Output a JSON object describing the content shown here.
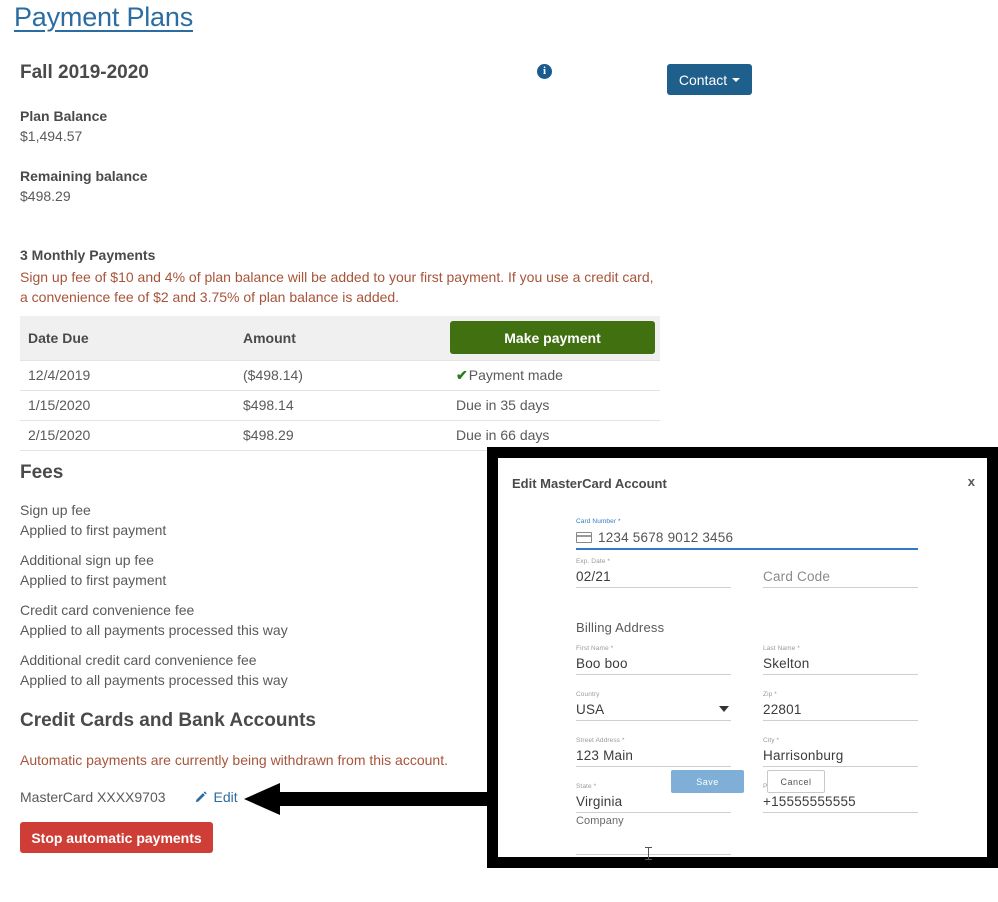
{
  "page": {
    "title": "Payment Plans"
  },
  "plan": {
    "name": "Fall 2019-2020",
    "info_icon": "info-icon",
    "contact_button": "Contact",
    "plan_balance_label": "Plan Balance",
    "plan_balance_value": "$1,494.57",
    "remaining_balance_label": "Remaining balance",
    "remaining_balance_value": "$498.29"
  },
  "schedule": {
    "title": "3 Monthly Payments",
    "note": "Sign up fee of $10 and 4% of plan balance will be added to your first payment. If you use a credit card, a convenience fee of $2 and 3.75% of plan balance is added.",
    "headers": [
      "Date Due",
      "Amount"
    ],
    "make_payment_button": "Make payment",
    "rows": [
      {
        "date": "12/4/2019",
        "amount": "($498.14)",
        "status": "Payment made",
        "paid": true
      },
      {
        "date": "1/15/2020",
        "amount": "$498.14",
        "status": "Due in 35 days",
        "paid": false
      },
      {
        "date": "2/15/2020",
        "amount": "$498.29",
        "status": "Due in 66 days",
        "paid": false
      }
    ]
  },
  "fees": {
    "heading": "Fees",
    "items": [
      {
        "name": "Sign up fee",
        "description": "Applied to first payment"
      },
      {
        "name": "Additional sign up fee",
        "description": "Applied to first payment"
      },
      {
        "name": "Credit card convenience fee",
        "description": "Applied to all payments processed this way"
      },
      {
        "name": "Additional credit card convenience fee",
        "description": "Applied to all payments processed this way"
      }
    ]
  },
  "accounts": {
    "heading": "Credit Cards and Bank Accounts",
    "auto_payment_note": "Automatic payments are currently being withdrawn from this account.",
    "account_label": "MasterCard XXXX9703",
    "edit_link": "Edit",
    "stop_payments_button": "Stop automatic payments"
  },
  "modal": {
    "title": "Edit MasterCard Account",
    "close_label": "x",
    "card_number": {
      "label": "Card Number *",
      "value": "1234 5678 9012 3456"
    },
    "exp_date": {
      "label": "Exp. Date *",
      "value": "02/21"
    },
    "card_code": {
      "label": "",
      "placeholder": "Card Code"
    },
    "billing_heading": "Billing Address",
    "first_name": {
      "label": "First Name *",
      "value": "Boo boo"
    },
    "last_name": {
      "label": "Last Name *",
      "value": "Skelton"
    },
    "country": {
      "label": "Country",
      "value": "USA"
    },
    "zip": {
      "label": "Zip *",
      "value": "22801"
    },
    "street_address": {
      "label": "Street Address *",
      "value": "123 Main"
    },
    "city": {
      "label": "City *",
      "value": "Harrisonburg"
    },
    "state": {
      "label": "State *",
      "value": "Virginia"
    },
    "phone_number": {
      "label": "Phone Number",
      "value": "+15555555555"
    },
    "company": {
      "label": "Company",
      "value": ""
    },
    "save_button": "Save",
    "cancel_button": "Cancel"
  },
  "colors": {
    "link_blue": "#2b6ca3",
    "button_blue": "#1f5f8b",
    "green": "#40700f",
    "red": "#cf3e36",
    "warn_orange": "#a8543a",
    "focus_blue": "#2f7cc4",
    "save_blue": "#7fafd6"
  }
}
